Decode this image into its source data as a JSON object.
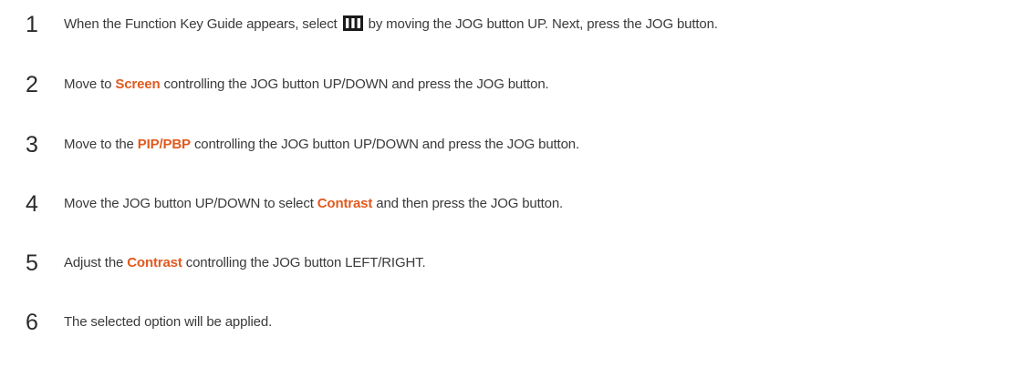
{
  "steps": [
    {
      "number": "1",
      "text_before": "When the Function Key Guide appears, select",
      "icon": "menu-icon",
      "text_after": "by moving the JOG button UP. Next, press the JOG button."
    },
    {
      "number": "2",
      "text_before": "Move to",
      "highlight": "Screen",
      "text_after": "controlling the JOG button UP/DOWN and press the JOG button."
    },
    {
      "number": "3",
      "text_before": "Move to the",
      "highlight": "PIP/PBP",
      "text_after": "controlling the JOG button UP/DOWN and press the JOG button."
    },
    {
      "number": "4",
      "text_before": "Move the JOG button UP/DOWN to select",
      "highlight": "Contrast",
      "text_after": "and then press the JOG button."
    },
    {
      "number": "5",
      "text_before": "Adjust the",
      "highlight": "Contrast",
      "text_after": "controlling the JOG button LEFT/RIGHT."
    },
    {
      "number": "6",
      "text_before": "The selected option will be applied."
    }
  ],
  "colors": {
    "highlight": "#e05a1f",
    "text": "#3a3a3a",
    "number": "#2b2b2b"
  }
}
